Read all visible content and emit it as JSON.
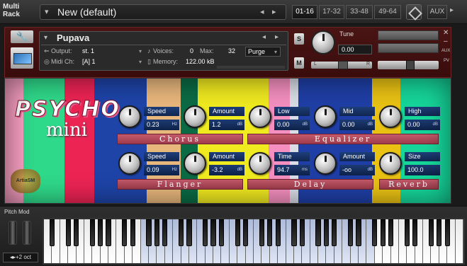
{
  "rack": {
    "label_line1": "Multi",
    "label_line2": "Rack",
    "preset_name": "New (default)",
    "prev_arrow": "◂",
    "next_arrow": "▸",
    "preset_menu_arrow": "▾",
    "pages": [
      "01-16",
      "17-32",
      "33-48",
      "49-64"
    ],
    "active_page": "01-16",
    "aux_label": "AUX",
    "aux_arrow": "▸"
  },
  "instrument": {
    "name": "Pupava",
    "output_label": "Output:",
    "output_value": "st. 1",
    "midi_label": "Midi Ch:",
    "midi_value": "[A]  1",
    "voices_label": "Voices:",
    "voices_value": "0",
    "max_label": "Max:",
    "max_value": "32",
    "purge_label": "Purge",
    "memory_label": "Memory:",
    "memory_value": "122.00 kB",
    "solo_label": "S",
    "mute_label": "M",
    "tune_label": "Tune",
    "tune_value": "0.00",
    "pan_left": "L",
    "pan_right": "R",
    "close": "✕",
    "minimize": "–",
    "aux_mini": "AUX",
    "pv_mini": "PV"
  },
  "panel": {
    "logo_main": "PSYCHO",
    "logo_sub": "mini",
    "badge": "ArtiaSM",
    "stripe_colors": [
      "#f79ec0",
      "#2fd98a",
      "#ec2454",
      "#1e44a8",
      "#e8b77c",
      "#0b6b45",
      "#f0ea20",
      "#f48fbf",
      "#d8dde6",
      "#1f3fa6",
      "#e9c214",
      "#16d69a"
    ],
    "chorus": {
      "title": "Chorus",
      "speed_label": "Speed",
      "speed_value": "0.23",
      "speed_unit": "Hz",
      "amount_label": "Amount",
      "amount_value": "1.2",
      "amount_unit": "dB"
    },
    "equalizer": {
      "title": "Equalizer",
      "low_label": "Low",
      "low_value": "0.00",
      "low_unit": "dB",
      "mid_label": "Mid",
      "mid_value": "0.00",
      "mid_unit": "dB",
      "high_label": "High",
      "high_value": "0.00",
      "high_unit": "dB"
    },
    "flanger": {
      "title": "Flanger",
      "speed_label": "Speed",
      "speed_value": "0.09",
      "speed_unit": "Hz",
      "amount_label": "Amount",
      "amount_value": "-3.2",
      "amount_unit": "dB"
    },
    "delay": {
      "title": "Delay",
      "time_label": "Time",
      "time_value": "94.7",
      "time_unit": "ms",
      "amount_label": "Amount",
      "amount_value": "-oo",
      "amount_unit": "dB"
    },
    "reverb": {
      "title": "Reverb",
      "size_label": "Size",
      "size_value": "100.0"
    }
  },
  "keyboard": {
    "pitch_mod_label": "Pitch Mod",
    "octave_label": "+2 oct",
    "octave_down": "◂",
    "octave_up": "▸"
  }
}
